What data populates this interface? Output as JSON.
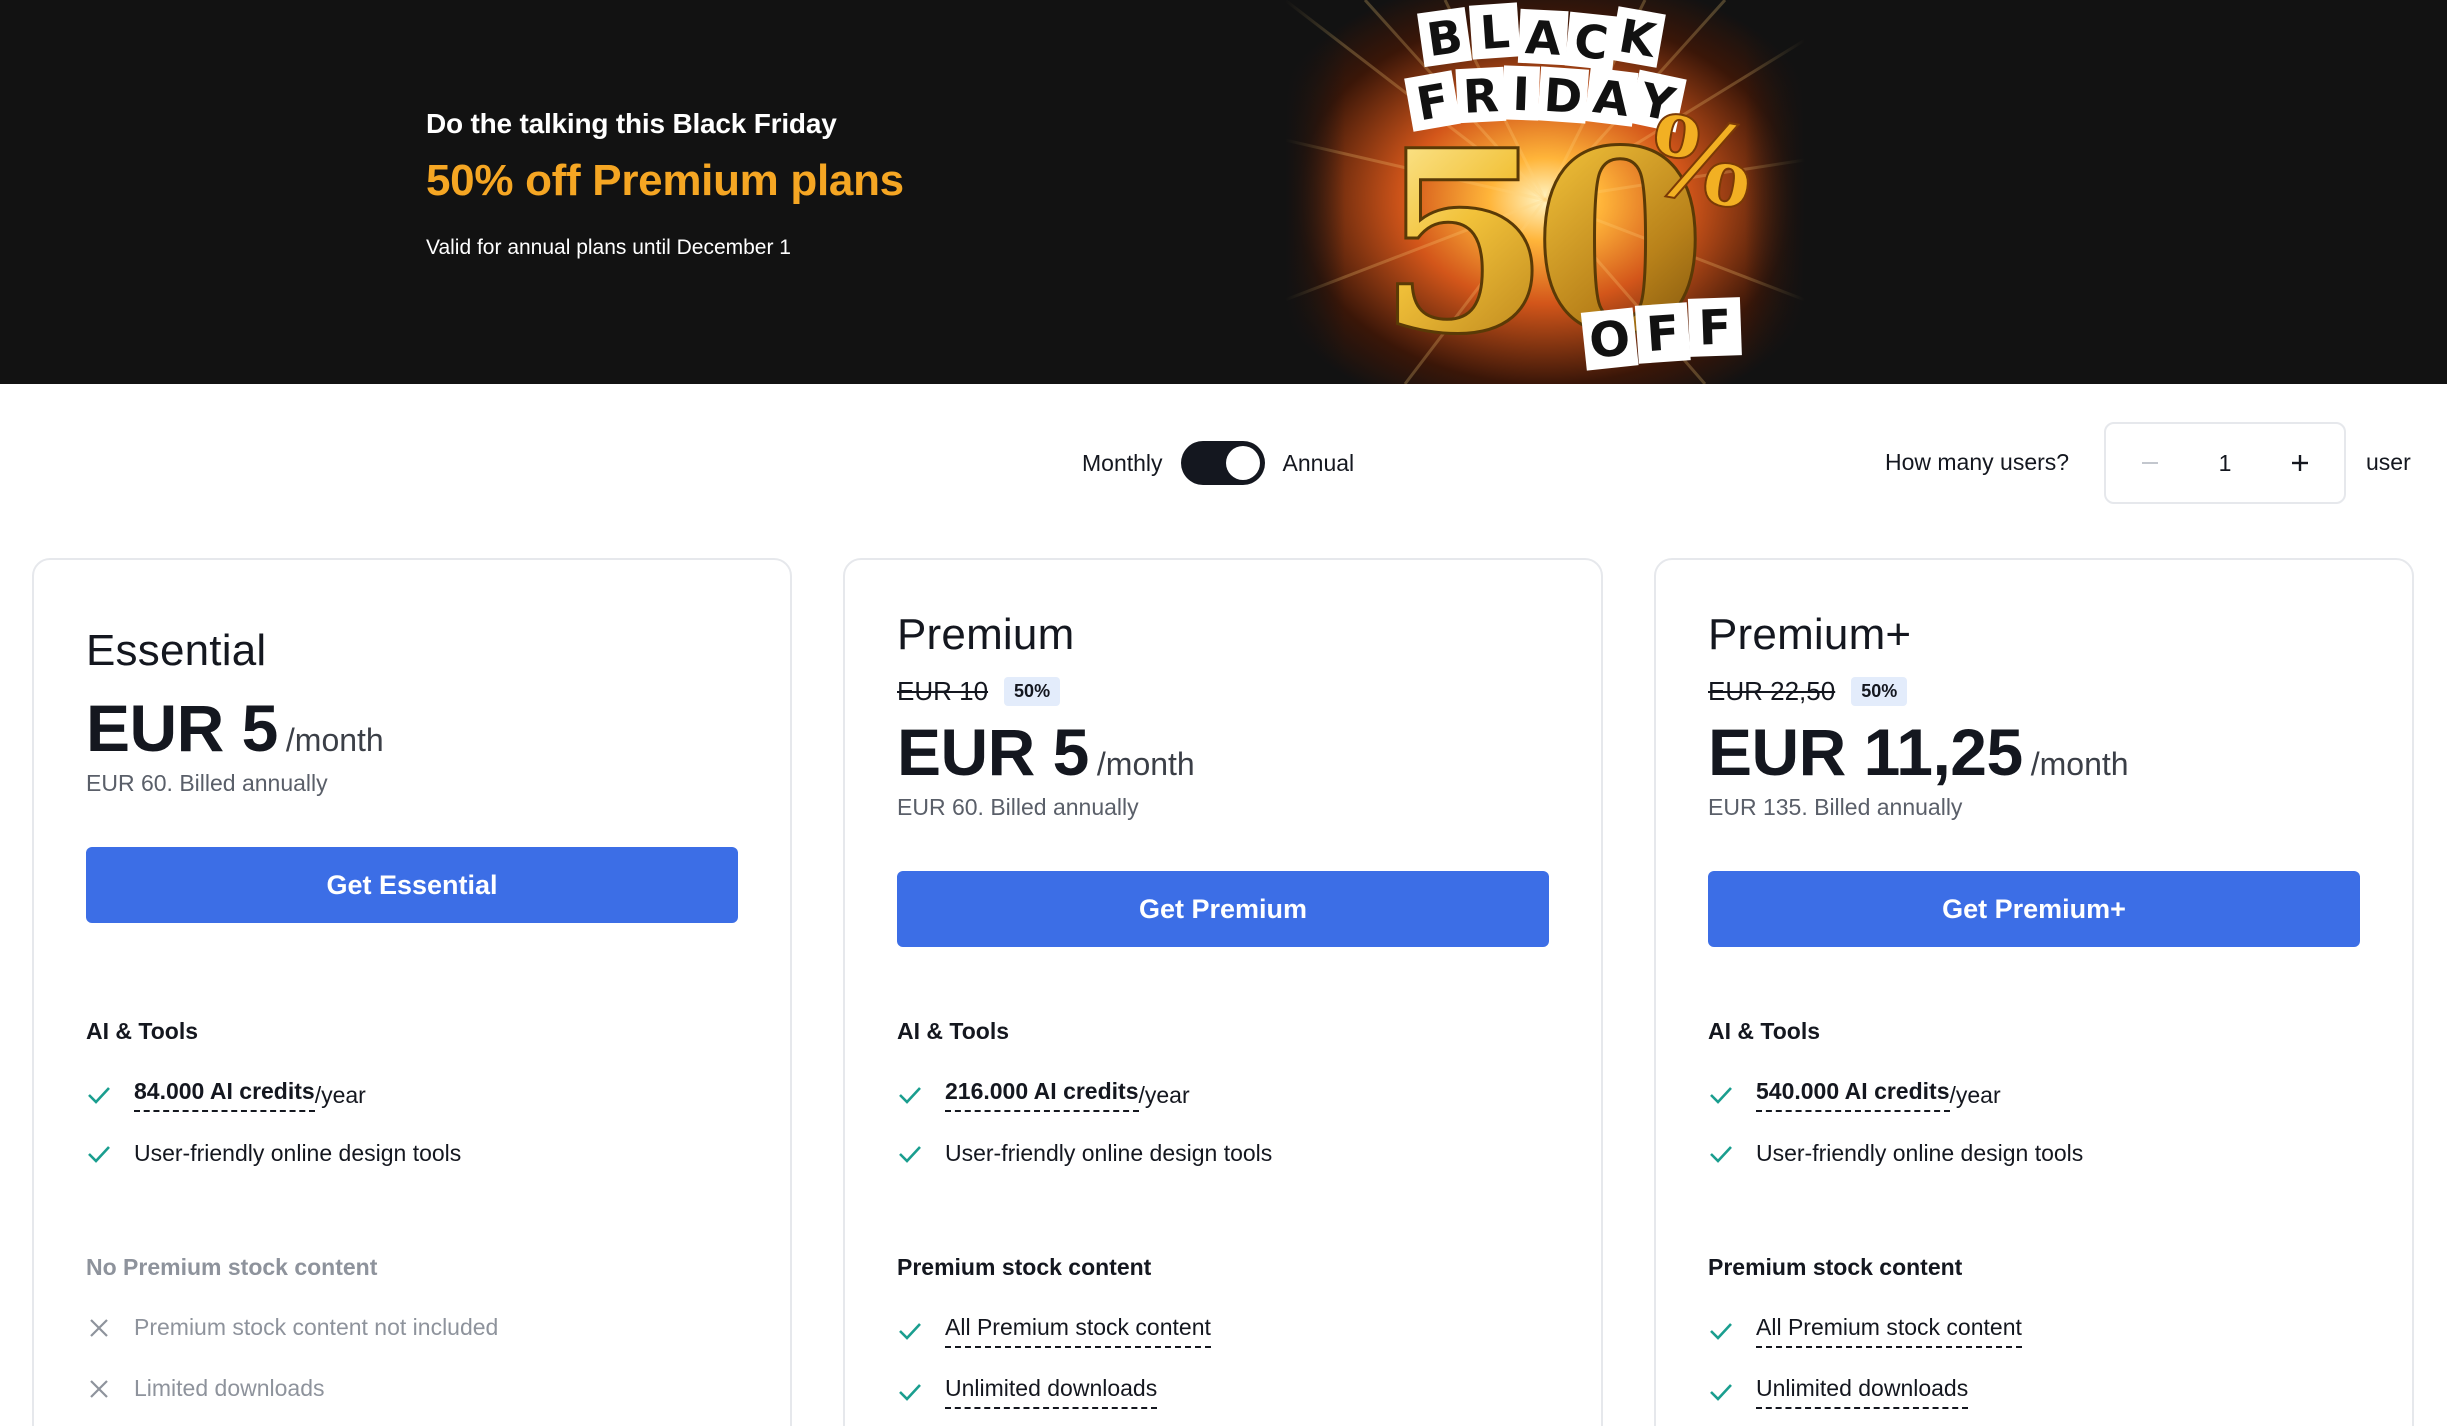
{
  "banner": {
    "kicker": "Do the talking this Black Friday",
    "headline": "50% off Premium plans",
    "valid": "Valid for annual plans until December 1",
    "art": {
      "line1": "BLACK",
      "line2": "FRIDAY",
      "big": "50%",
      "off": "OFF"
    }
  },
  "billing": {
    "monthly_label": "Monthly",
    "annual_label": "Annual",
    "selected": "Annual"
  },
  "users": {
    "label": "How many users?",
    "value": "1",
    "unit": "user"
  },
  "colors": {
    "accent": "#3c6ee6",
    "promo": "#f5a623",
    "check": "#1a9e8f",
    "banner_bg": "#121212",
    "badge_bg": "#e3ecfb"
  },
  "plans": [
    {
      "name": "Essential",
      "price": "EUR 5",
      "per": "/month",
      "billed": "EUR 60. Billed annually",
      "cta": "Get Essential",
      "ai_section": "AI & Tools",
      "ai_credits_bold": "84.000 AI credits",
      "ai_credits_suffix": "/year",
      "tools": "User-friendly online design tools",
      "stock_section": "No Premium stock content",
      "stock_1": "Premium stock content not included",
      "stock_2": "Limited downloads",
      "stock_icon": "x-icon"
    },
    {
      "name": "Premium",
      "old_price": "EUR 10",
      "badge": "50%",
      "price": "EUR 5",
      "per": "/month",
      "billed": "EUR 60. Billed annually",
      "cta": "Get Premium",
      "ai_section": "AI & Tools",
      "ai_credits_bold": "216.000 AI credits",
      "ai_credits_suffix": "/year",
      "tools": "User-friendly online design tools",
      "stock_section": "Premium stock content",
      "stock_1": "All Premium stock content",
      "stock_2": "Unlimited downloads",
      "stock_icon": "check-icon"
    },
    {
      "name": "Premium+",
      "old_price": "EUR 22,50",
      "badge": "50%",
      "price": "EUR 11,25",
      "per": "/month",
      "billed": "EUR 135. Billed annually",
      "cta": "Get Premium+",
      "ai_section": "AI & Tools",
      "ai_credits_bold": "540.000 AI credits",
      "ai_credits_suffix": "/year",
      "tools": "User-friendly online design tools",
      "stock_section": "Premium stock content",
      "stock_1": "All Premium stock content",
      "stock_2": "Unlimited downloads",
      "stock_icon": "check-icon"
    }
  ]
}
